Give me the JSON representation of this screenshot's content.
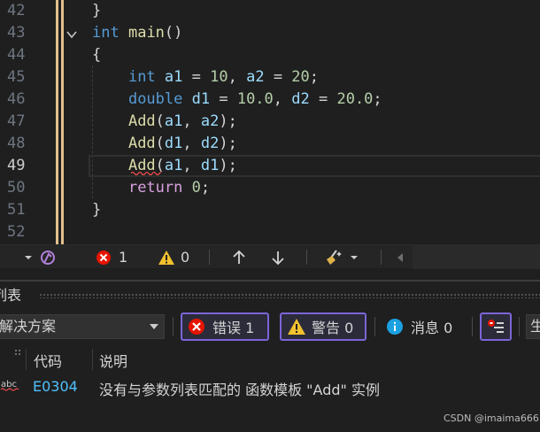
{
  "editor": {
    "lines": [
      {
        "num": "42",
        "tokens": [
          {
            "t": "}",
            "c": "pl"
          }
        ]
      },
      {
        "num": "43",
        "tokens": [
          {
            "t": "int",
            "c": "kw"
          },
          {
            "t": " ",
            "c": "pl"
          },
          {
            "t": "main",
            "c": "fn"
          },
          {
            "t": "()",
            "c": "pl"
          }
        ]
      },
      {
        "num": "44",
        "tokens": [
          {
            "t": "{",
            "c": "pl"
          }
        ]
      },
      {
        "num": "45",
        "tokens": [
          {
            "t": "    ",
            "c": "pl"
          },
          {
            "t": "int",
            "c": "kw"
          },
          {
            "t": " ",
            "c": "pl"
          },
          {
            "t": "a1",
            "c": "vr"
          },
          {
            "t": " = ",
            "c": "pl"
          },
          {
            "t": "10",
            "c": "nm"
          },
          {
            "t": ", ",
            "c": "pl"
          },
          {
            "t": "a2",
            "c": "vr"
          },
          {
            "t": " = ",
            "c": "pl"
          },
          {
            "t": "20",
            "c": "nm"
          },
          {
            "t": ";",
            "c": "pl"
          }
        ]
      },
      {
        "num": "46",
        "tokens": [
          {
            "t": "    ",
            "c": "pl"
          },
          {
            "t": "double",
            "c": "kw"
          },
          {
            "t": " ",
            "c": "pl"
          },
          {
            "t": "d1",
            "c": "vr"
          },
          {
            "t": " = ",
            "c": "pl"
          },
          {
            "t": "10.0",
            "c": "nm"
          },
          {
            "t": ", ",
            "c": "pl"
          },
          {
            "t": "d2",
            "c": "vr"
          },
          {
            "t": " = ",
            "c": "pl"
          },
          {
            "t": "20.0",
            "c": "nm"
          },
          {
            "t": ";",
            "c": "pl"
          }
        ]
      },
      {
        "num": "47",
        "tokens": [
          {
            "t": "    ",
            "c": "pl"
          },
          {
            "t": "Add",
            "c": "fn"
          },
          {
            "t": "(",
            "c": "pl"
          },
          {
            "t": "a1",
            "c": "vr"
          },
          {
            "t": ", ",
            "c": "pl"
          },
          {
            "t": "a2",
            "c": "vr"
          },
          {
            "t": ");",
            "c": "pl"
          }
        ]
      },
      {
        "num": "48",
        "tokens": [
          {
            "t": "    ",
            "c": "pl"
          },
          {
            "t": "Add",
            "c": "fn"
          },
          {
            "t": "(",
            "c": "pl"
          },
          {
            "t": "d1",
            "c": "vr"
          },
          {
            "t": ", ",
            "c": "pl"
          },
          {
            "t": "d2",
            "c": "vr"
          },
          {
            "t": ");",
            "c": "pl"
          }
        ]
      },
      {
        "num": "49",
        "tokens": [
          {
            "t": "    ",
            "c": "pl"
          },
          {
            "t": "Add",
            "c": "fn"
          },
          {
            "t": "(",
            "c": "pl"
          },
          {
            "t": "a1",
            "c": "vr"
          },
          {
            "t": ", ",
            "c": "pl"
          },
          {
            "t": "d1",
            "c": "vr"
          },
          {
            "t": ");",
            "c": "pl"
          }
        ]
      },
      {
        "num": "50",
        "tokens": [
          {
            "t": "    ",
            "c": "pl"
          },
          {
            "t": "return",
            "c": "ctl"
          },
          {
            "t": " ",
            "c": "pl"
          },
          {
            "t": "0",
            "c": "nm"
          },
          {
            "t": ";",
            "c": "pl"
          }
        ]
      },
      {
        "num": "51",
        "tokens": [
          {
            "t": "}",
            "c": "pl"
          }
        ]
      },
      {
        "num": "52",
        "tokens": []
      }
    ],
    "active_line": "49"
  },
  "status_strip": {
    "error_count": "1",
    "warning_count": "0"
  },
  "error_list": {
    "title": "列表",
    "scope_selected": "解决方案",
    "errors_label": "错误 1",
    "warnings_label": "警告 0",
    "messages_label": "消息 0",
    "partial_button": "生",
    "columns": {
      "code": "代码",
      "description": "说明"
    },
    "rows": [
      {
        "code": "E0304",
        "description": "没有与参数列表匹配的 函数模板 \"Add\" 实例"
      }
    ]
  },
  "colors": {
    "background": "#1f1f1f",
    "keyword": "#569cd6",
    "function": "#dcdcaa",
    "variable": "#9cdcfe",
    "number": "#b5cea8",
    "control": "#d8a0df",
    "accent": "#7c65d6",
    "error_red": "#e51400",
    "warning_yellow": "#f2c12e"
  },
  "watermark": "CSDN @imaima666"
}
